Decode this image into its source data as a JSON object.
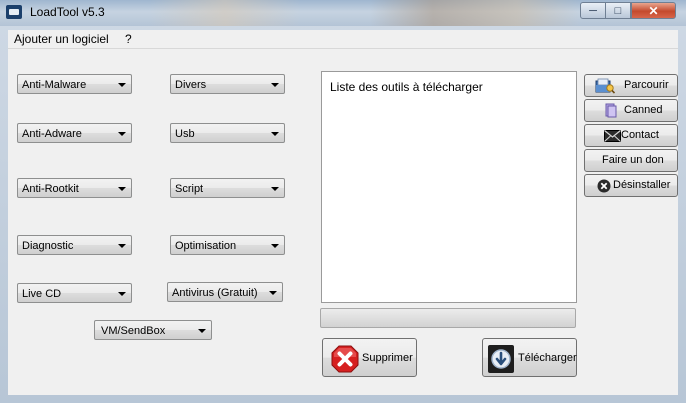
{
  "window": {
    "title": "LoadTool v5.3",
    "controls": {
      "minimize": "─",
      "maximize": "□",
      "close": "✕"
    }
  },
  "menu": {
    "add_software": "Ajouter un logiciel",
    "help": "?"
  },
  "categories": {
    "anti_malware": "Anti-Malware",
    "divers": "Divers",
    "anti_adware": "Anti-Adware",
    "usb": "Usb",
    "anti_rootkit": "Anti-Rootkit",
    "script": "Script",
    "diagnostic": "Diagnostic",
    "optimisation": "Optimisation",
    "live_cd": "Live CD",
    "antivirus": "Antivirus (Gratuit)",
    "vm_sandbox": "VM/SendBox"
  },
  "download_list": {
    "header": "Liste des outils à télécharger",
    "items": [],
    "progress": 0
  },
  "side_buttons": {
    "parcourir": "Parcourir",
    "canned": "Canned",
    "contact": "Contact",
    "don": "Faire un don",
    "desinstaller": "Désinstaller"
  },
  "actions": {
    "supprimer": "Supprimer",
    "telecharger": "Télécharger"
  },
  "icons": {
    "folder": "folder-icon",
    "canned": "canned-icon",
    "mail": "mail-icon",
    "uninstall": "uninstall-icon",
    "delete": "delete-icon",
    "download": "download-icon"
  },
  "colors": {
    "close_red": "#c44a2d",
    "delete_red": "#d62020",
    "download_blue": "#2a4f7c"
  }
}
